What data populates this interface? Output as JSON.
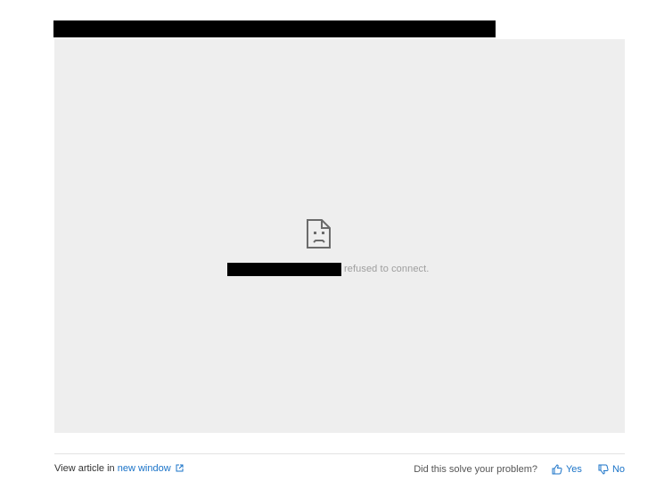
{
  "error": {
    "suffix": "refused to connect."
  },
  "footer": {
    "view_article_prefix": "View article in",
    "new_window_link": "new window",
    "question": "Did this solve your problem?",
    "yes_label": "Yes",
    "no_label": "No"
  },
  "icons": {
    "error_icon": "sad-document-icon",
    "external_link_icon": "external-link-icon",
    "yes_icon": "thumbs-up-icon",
    "no_icon": "thumbs-down-icon"
  },
  "colors": {
    "frame_background": "#eeeeee",
    "link": "#1a73c8",
    "muted_text": "#9e9e9e"
  }
}
